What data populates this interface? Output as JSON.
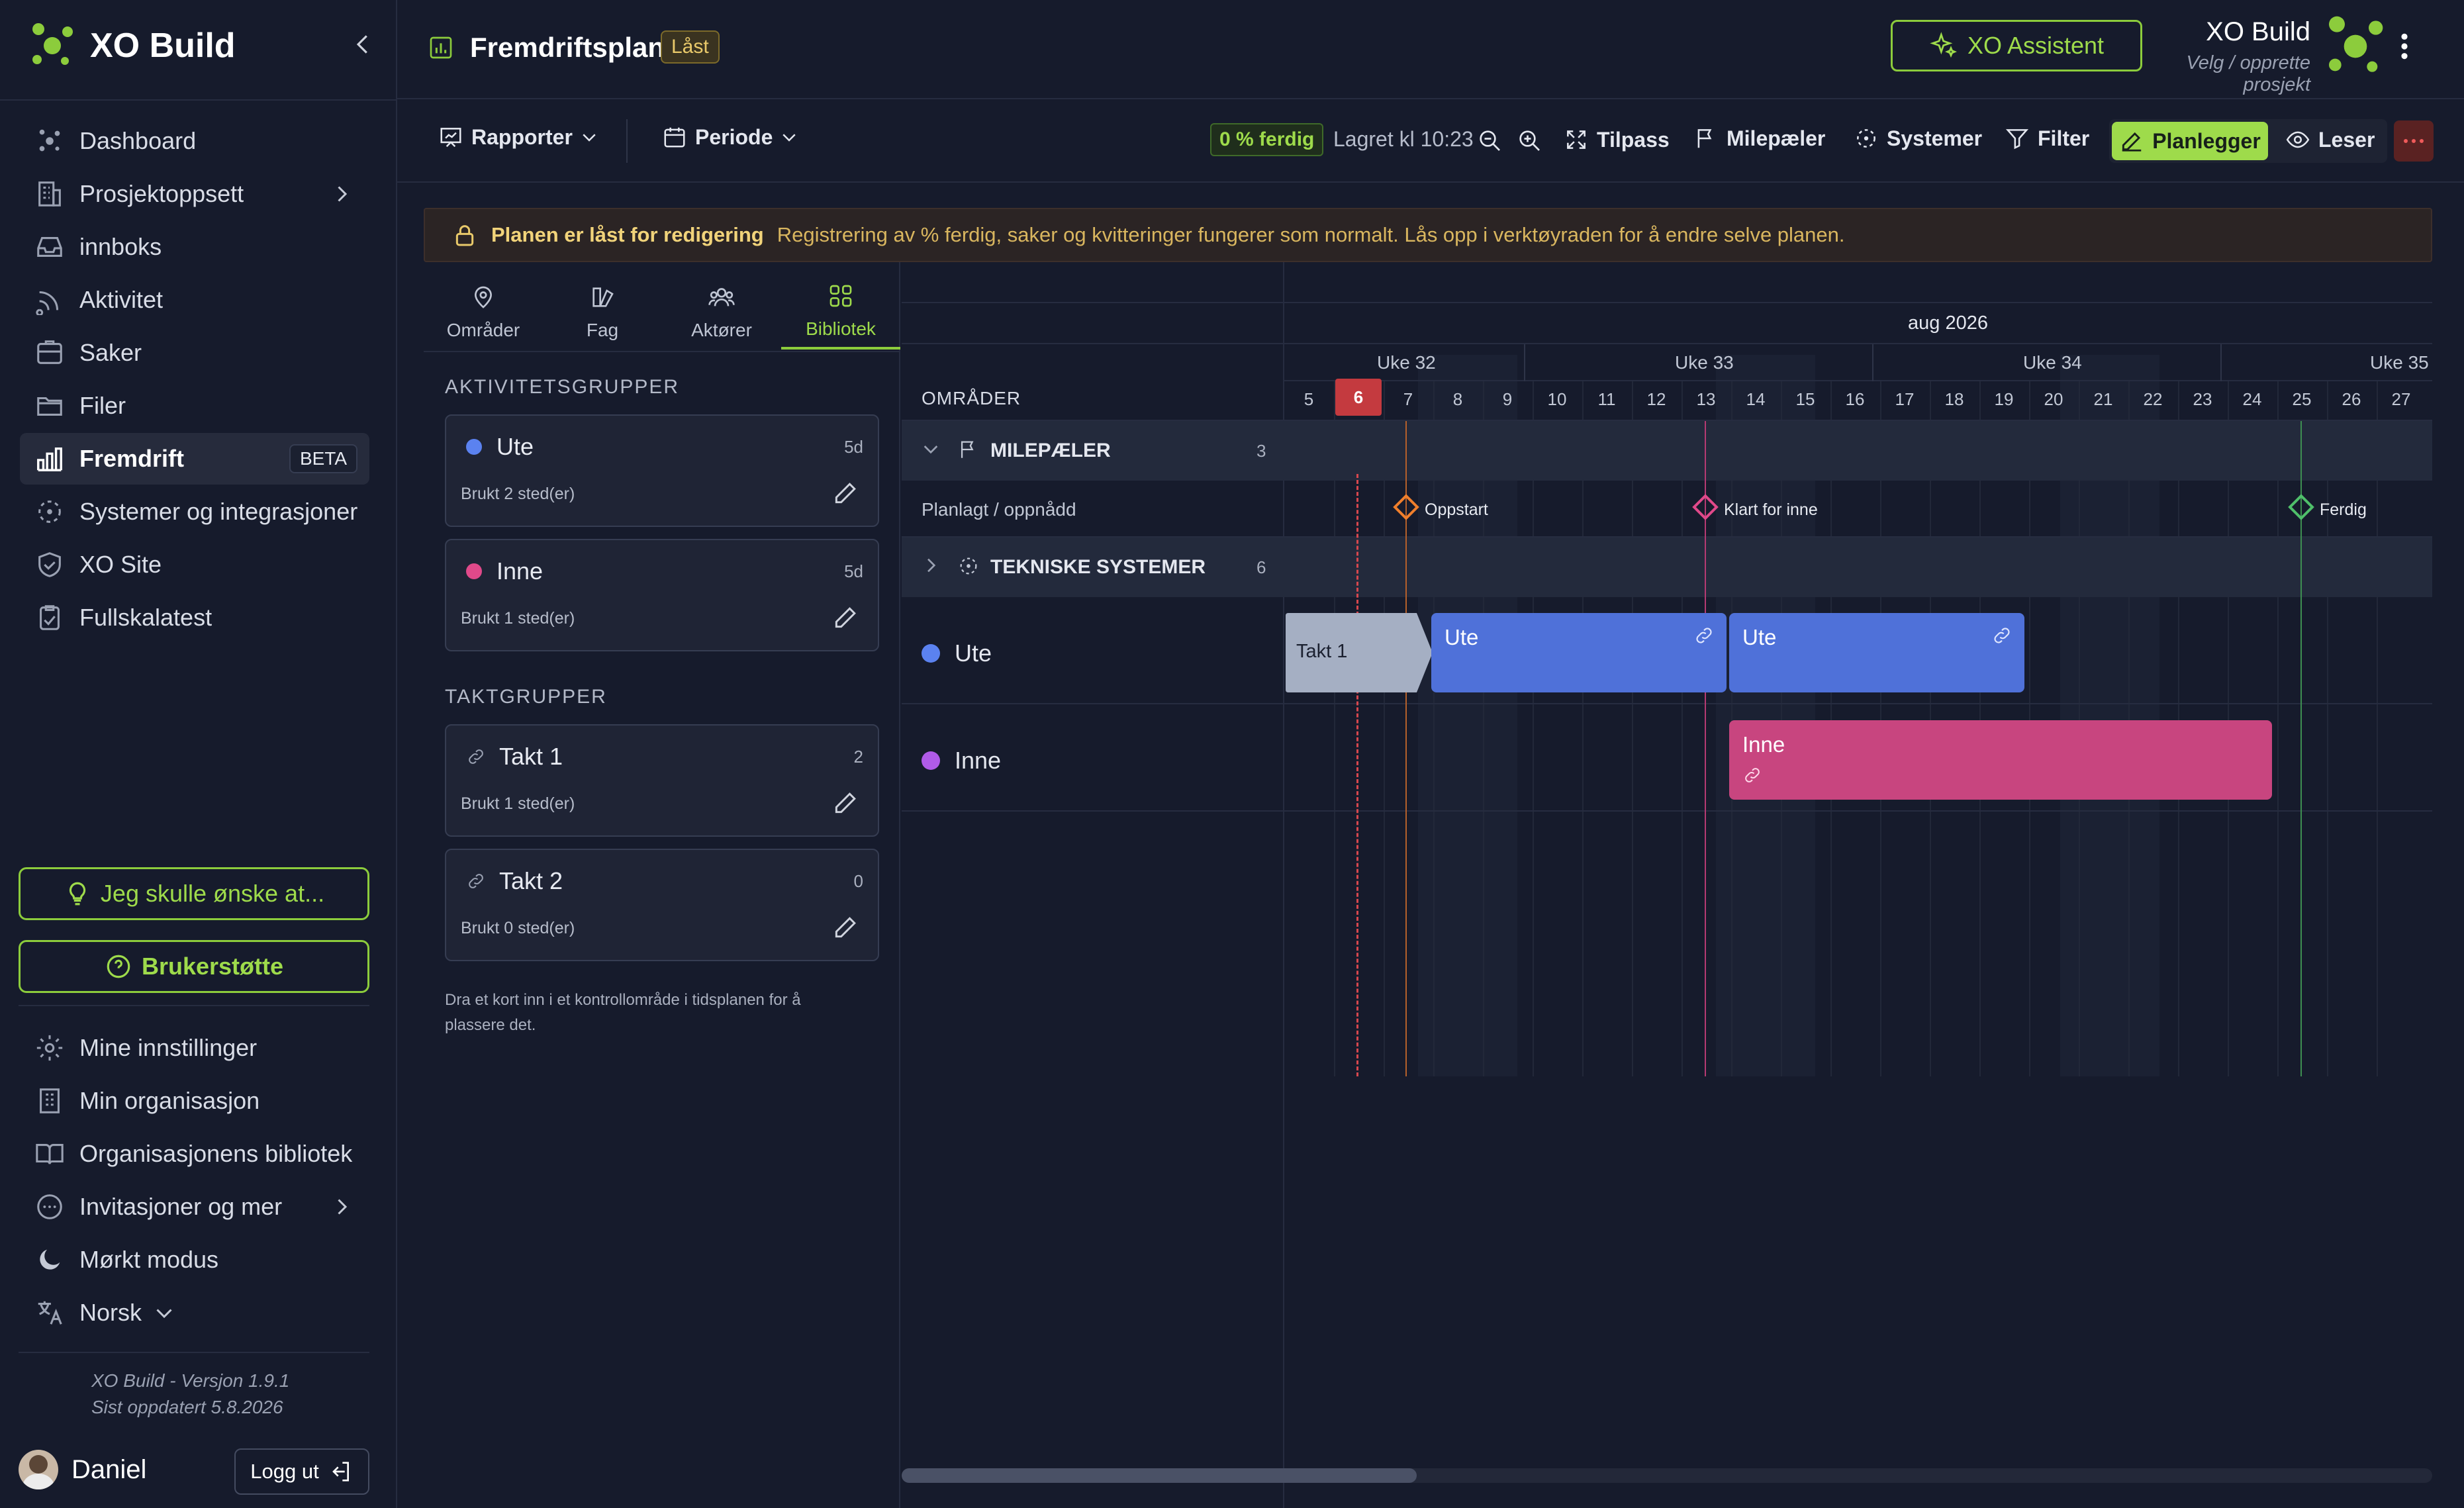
{
  "app": {
    "name": "XO Build",
    "project_name": "XO Build",
    "project_hint": "Velg / opprette prosjekt",
    "assistant_label": "XO Assistent"
  },
  "sidebar": {
    "items": [
      {
        "label": "Dashboard",
        "icon": "dashboard-icon"
      },
      {
        "label": "Prosjektoppsett",
        "icon": "building-icon"
      },
      {
        "label": "innboks",
        "icon": "inbox-icon"
      },
      {
        "label": "Aktivitet",
        "icon": "activity-icon"
      },
      {
        "label": "Saker",
        "icon": "cases-icon"
      },
      {
        "label": "Filer",
        "icon": "folder-icon"
      },
      {
        "label": "Fremdrift",
        "icon": "chart-icon",
        "badge": "BETA"
      },
      {
        "label": "Systemer og integrasjoner",
        "icon": "systems-icon"
      },
      {
        "label": "XO Site",
        "icon": "shield-icon"
      },
      {
        "label": "Fullskalatest",
        "icon": "clipboard-icon"
      }
    ],
    "wish_label": "Jeg skulle ønske at...",
    "support_label": "Brukerstøtte",
    "bottom_items": [
      {
        "label": "Mine innstillinger",
        "icon": "gear-icon"
      },
      {
        "label": "Min organisasjon",
        "icon": "organization-icon"
      },
      {
        "label": "Organisasjonens bibliotek",
        "icon": "book-icon"
      },
      {
        "label": "Invitasjoner og mer",
        "icon": "more-icon"
      },
      {
        "label": "Mørkt modus",
        "icon": "moon-icon"
      },
      {
        "label": "Norsk",
        "icon": "language-icon"
      }
    ],
    "version": "XO Build - Versjon 1.9.1",
    "updated": "Sist oppdatert 5.8.2026",
    "user_name": "Daniel",
    "logout_label": "Logg ut"
  },
  "header": {
    "title": "Fremdriftsplan",
    "lock_badge": "Låst"
  },
  "toolbar": {
    "reports": "Rapporter",
    "period": "Periode",
    "progress": "0 % ferdig",
    "saved": "Lagret kl 10:23",
    "fit": "Tilpass",
    "milestones": "Milepæler",
    "systems": "Systemer",
    "filter": "Filter",
    "planner": "Planlegger",
    "reader": "Leser"
  },
  "banner": {
    "title": "Planen er låst for redigering",
    "text": "Registrering av % ferdig, saker og kvitteringer fungerer som normalt. Lås opp i verktøyraden for å endre selve planen."
  },
  "library": {
    "tabs": [
      "Områder",
      "Fag",
      "Aktører",
      "Bibliotek"
    ],
    "activity_groups_title": "AKTIVITETSGRUPPER",
    "activity_groups": [
      {
        "name": "Ute",
        "count": "5d",
        "used": "Brukt 2 sted(er)",
        "color": "#5b82f0"
      },
      {
        "name": "Inne",
        "count": "5d",
        "used": "Brukt 1 sted(er)",
        "color": "#e0498a"
      }
    ],
    "takt_groups_title": "TAKTGRUPPER",
    "takt_groups": [
      {
        "name": "Takt 1",
        "count": "2",
        "used": "Brukt 1 sted(er)"
      },
      {
        "name": "Takt 2",
        "count": "0",
        "used": "Brukt 0 sted(er)"
      }
    ],
    "hint": "Dra et kort inn i et kontrollområde i tidsplanen for å plassere det."
  },
  "gantt": {
    "month": "aug 2026",
    "areas_header": "OMRÅDER",
    "weeks": [
      "Uke 32",
      "Uke 33",
      "Uke 34",
      "Uke 35"
    ],
    "days": [
      "5",
      "6",
      "7",
      "8",
      "9",
      "10",
      "11",
      "12",
      "13",
      "14",
      "15",
      "16",
      "17",
      "18",
      "19",
      "20",
      "21",
      "22",
      "23",
      "24",
      "25",
      "26",
      "27"
    ],
    "today": "6",
    "milestones_group": "MILEPÆLER",
    "milestones_count": "3",
    "planned_label": "Planlagt / oppnådd",
    "milestones": [
      {
        "label": "Oppstart",
        "color": "#f07f2c"
      },
      {
        "label": "Klart for inne",
        "color": "#e0498a"
      },
      {
        "label": "Ferdig",
        "color": "#4fbf6a"
      }
    ],
    "systems_group": "TEKNISKE SYSTEMER",
    "systems_count": "6",
    "rows": [
      {
        "name": "Ute",
        "color": "#5b82f0"
      },
      {
        "name": "Inne",
        "color": "#b05be8"
      }
    ],
    "bars": {
      "takt": "Takt 1",
      "ute_a": "Ute",
      "ute_b": "Ute",
      "inne": "Inne"
    }
  }
}
